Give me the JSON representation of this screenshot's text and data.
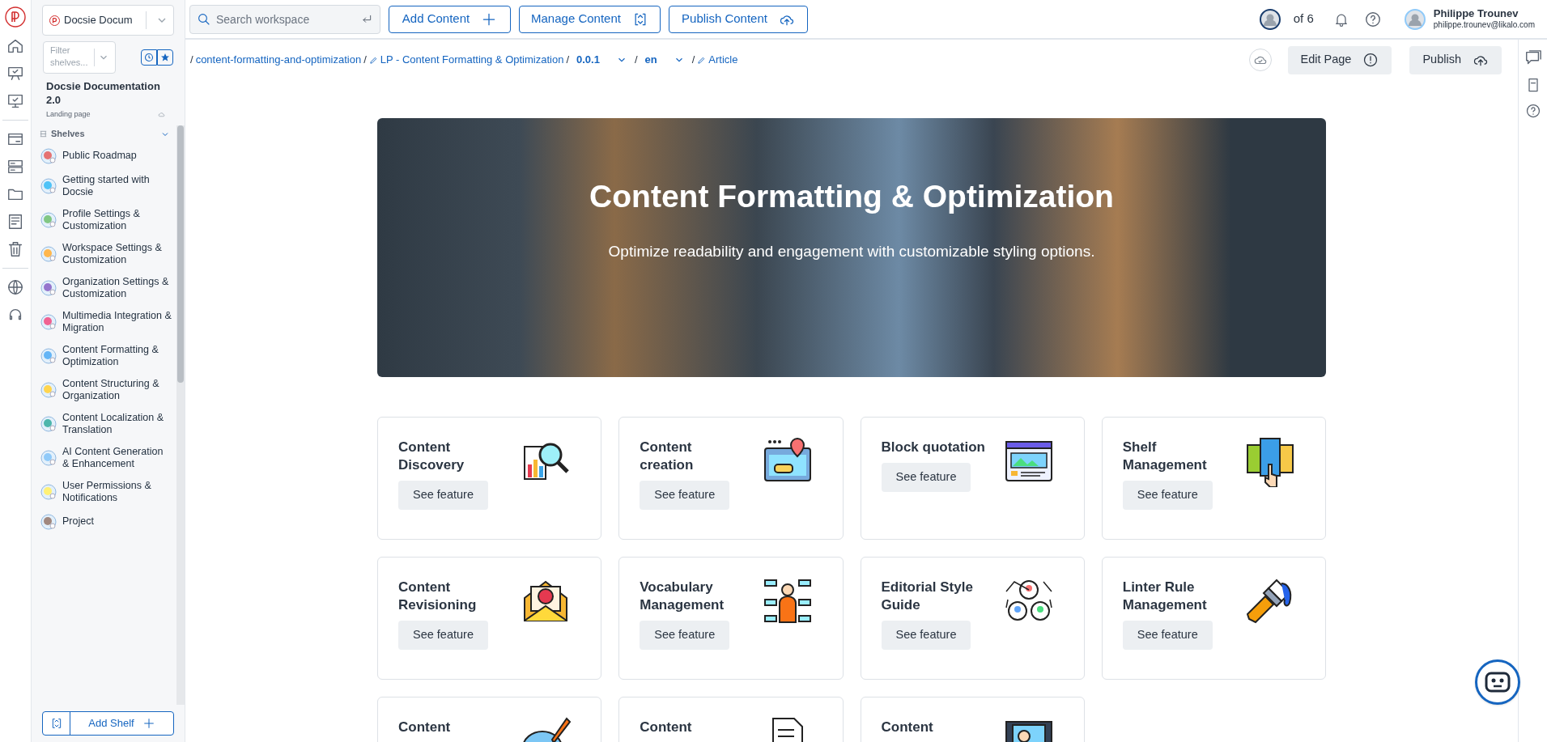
{
  "workspace_select": {
    "value": "Docsie Docum"
  },
  "shelf_filter": {
    "placeholder": "Filter shelves..."
  },
  "project": {
    "title": "Docsie Documentation 2.0",
    "subtitle": "Landing page"
  },
  "shelves": {
    "label": "Shelves",
    "expanded": true,
    "items": [
      {
        "label": "Public Roadmap"
      },
      {
        "label": "Getting started with Docsie"
      },
      {
        "label": "Profile Settings & Customization"
      },
      {
        "label": "Workspace Settings & Customization"
      },
      {
        "label": "Organization Settings & Customization"
      },
      {
        "label": "Multimedia Integration & Migration"
      },
      {
        "label": "Content Formatting & Optimization"
      },
      {
        "label": "Content Structuring & Organization"
      },
      {
        "label": "Content Localization & Translation"
      },
      {
        "label": "AI Content Generation & Enhancement"
      },
      {
        "label": "User Permissions & Notifications"
      },
      {
        "label": "Project"
      }
    ]
  },
  "add_shelf": "Add Shelf",
  "search": {
    "placeholder": "Search workspace"
  },
  "toolbar_buttons": [
    {
      "label": "Add Content",
      "kind": "add"
    },
    {
      "label": "Manage Content",
      "kind": "manage"
    },
    {
      "label": "Publish Content",
      "kind": "publish"
    }
  ],
  "collaborators": "of 6",
  "user": {
    "name": "Philippe Trounev",
    "email": "philippe.trounev@likalo.com"
  },
  "breadcrumb": [
    {
      "separator": "/",
      "text": "content-formatting-and-optimization",
      "kind": "link"
    },
    {
      "separator": "/",
      "text": "LP - Content Formatting & Optimization",
      "kind": "editable"
    },
    {
      "separator": "/",
      "text": "0.0.1",
      "kind": "dropdown"
    },
    {
      "separator": "/",
      "text": "en",
      "kind": "dropdown"
    },
    {
      "separator": "/",
      "text": "Article",
      "kind": "editable"
    }
  ],
  "page_actions": [
    {
      "label": "Edit Page",
      "kind": "edit"
    },
    {
      "label": "Publish",
      "kind": "publish"
    }
  ],
  "hero": {
    "title": "Content Formatting & Optimization",
    "subtitle": "Optimize readability and engagement with customizable styling options."
  },
  "features": [
    {
      "title": "Content Discovery",
      "button": "See feature",
      "kind": "discovery"
    },
    {
      "title": "Content creation",
      "button": "See feature",
      "kind": "creation"
    },
    {
      "title": "Block quotation",
      "button": "See feature",
      "kind": "quotation"
    },
    {
      "title": "Shelf Management",
      "button": "See feature",
      "kind": "shelf"
    },
    {
      "title": "Content Revisioning",
      "button": "See feature",
      "kind": "revision"
    },
    {
      "title": "Vocabulary Management",
      "button": "See feature",
      "kind": "vocabulary"
    },
    {
      "title": "Editorial Style Guide",
      "button": "See feature",
      "kind": "style"
    },
    {
      "title": "Linter Rule Management",
      "button": "See feature",
      "kind": "linter"
    },
    {
      "title": "Content",
      "kind": "chat"
    },
    {
      "title": "Content",
      "kind": "document"
    },
    {
      "title": "Content",
      "kind": "media"
    }
  ]
}
